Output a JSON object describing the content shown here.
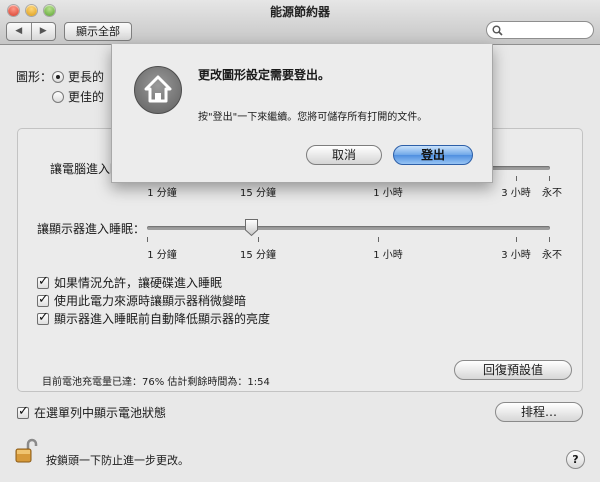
{
  "window": {
    "title": "能源節約器",
    "show_all": "顯示全部",
    "nav_back": "◀",
    "nav_forward": "▶",
    "search_placeholder": ""
  },
  "graphics": {
    "label": "圖形：",
    "options": [
      {
        "label": "更長的電池使用時間",
        "visible_text": "更長的",
        "selected": true
      },
      {
        "label": "更佳的效能",
        "visible_text": "更佳的",
        "selected": false
      }
    ]
  },
  "sliders": [
    {
      "label": "讓電腦進入睡眠：",
      "visible_label": "讓電腦進入睡",
      "value": "",
      "ticks": [
        "1 分鐘",
        "15 分鐘",
        "1 小時",
        "3 小時",
        "永不"
      ]
    },
    {
      "label": "讓顯示器進入睡眠：",
      "value": "15 分鐘",
      "ticks": [
        "1 分鐘",
        "15 分鐘",
        "1 小時",
        "3 小時",
        "永不"
      ]
    }
  ],
  "checkboxes": [
    {
      "label": "如果情況允許，讓硬碟進入睡眠",
      "checked": true
    },
    {
      "label": "使用此電力來源時讓顯示器稍微變暗",
      "checked": true
    },
    {
      "label": "顯示器進入睡眠前自動降低顯示器的亮度",
      "checked": true
    }
  ],
  "battery_status": "目前電池充電量已達：76%  估計剩餘時間為：1:54",
  "restore_defaults": "回復預設值",
  "show_battery_status": {
    "label": "在選單列中顯示電池狀態",
    "checked": true
  },
  "schedule": "排程…",
  "lock_text": "按鎖頭一下防止進一步更改。",
  "help": "?",
  "dialog": {
    "title": "更改圖形設定需要登出。",
    "message": "按\"登出\"一下來繼續。您將可儲存所有打開的文件。",
    "cancel": "取消",
    "logout": "登出"
  },
  "colors": {
    "default_button": "#4f8fe0",
    "window_bg": "#e8e8e8"
  }
}
